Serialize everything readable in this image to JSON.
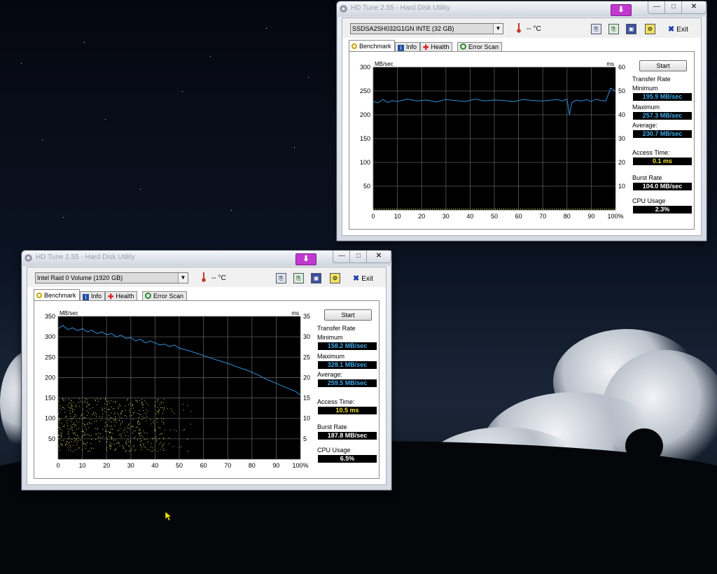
{
  "desktop": {
    "background": "night-sky-clouds"
  },
  "window_top": {
    "title": "HD Tune 2.55 - Hard Disk Utility",
    "drive": "SSDSA2SH032G1GN INTE (32 GB)",
    "temp": "-- °C",
    "exit_label": "Exit",
    "tabs": [
      "Benchmark",
      "Info",
      "Health",
      "Error Scan"
    ],
    "start_label": "Start",
    "stats": {
      "transfer_rate_label": "Transfer Rate",
      "minimum_label": "Minimum",
      "minimum": "195.9 MB/sec",
      "maximum_label": "Maximum",
      "maximum": "257.3 MB/sec",
      "average_label": "Average:",
      "average": "230.7 MB/sec",
      "access_time_label": "Access Time:",
      "access_time": "0.1 ms",
      "burst_rate_label": "Burst Rate",
      "burst_rate": "104.0 MB/sec",
      "cpu_usage_label": "CPU Usage",
      "cpu_usage": "2.3%"
    }
  },
  "window_bottom": {
    "title": "HD Tune 2.55 - Hard Disk Utility",
    "drive": "Intel   Raid 0 Volume (1920 GB)",
    "temp": "-- °C",
    "exit_label": "Exit",
    "tabs": [
      "Benchmark",
      "Info",
      "Health",
      "Error Scan"
    ],
    "start_label": "Start",
    "stats": {
      "transfer_rate_label": "Transfer Rate",
      "minimum_label": "Minimum",
      "minimum": "158.2 MB/sec",
      "maximum_label": "Maximum",
      "maximum": "328.1 MB/sec",
      "average_label": "Average:",
      "average": "259.5 MB/sec",
      "access_time_label": "Access Time:",
      "access_time": "10.5 ms",
      "burst_rate_label": "Burst Rate",
      "burst_rate": "187.8 MB/sec",
      "cpu_usage_label": "CPU Usage",
      "cpu_usage": "6.5%"
    }
  },
  "chart_data": [
    {
      "type": "line",
      "ylabel": "MB/sec",
      "y2label": "ms",
      "ylim": [
        0,
        300
      ],
      "y2lim": [
        0,
        60
      ],
      "yticks": [
        "300",
        "250",
        "200",
        "150",
        "100",
        "50"
      ],
      "y2ticks": [
        "60",
        "50",
        "40",
        "30",
        "20",
        "10"
      ],
      "xticks": [
        "0",
        "10",
        "20",
        "30",
        "40",
        "50",
        "60",
        "70",
        "80",
        "90",
        "100%"
      ],
      "grid": true,
      "series": [
        {
          "x": [
            0,
            2,
            4,
            6,
            8,
            10,
            14,
            18,
            22,
            26,
            30,
            34,
            38,
            42,
            46,
            50,
            54,
            58,
            62,
            66,
            70,
            74,
            76,
            78,
            80,
            81,
            82,
            84,
            86,
            88,
            90,
            92,
            94,
            96,
            98,
            100
          ],
          "values": [
            228,
            225,
            232,
            226,
            230,
            228,
            233,
            229,
            231,
            227,
            232,
            230,
            228,
            233,
            229,
            231,
            230,
            228,
            232,
            230,
            229,
            231,
            232,
            229,
            233,
            200,
            226,
            231,
            229,
            232,
            228,
            233,
            230,
            229,
            256,
            250
          ]
        }
      ],
      "access_time_points_ms": [
        0.1
      ]
    },
    {
      "type": "line",
      "ylabel": "MB/sec",
      "y2label": "ms",
      "ylim": [
        0,
        350
      ],
      "y2lim": [
        0,
        35
      ],
      "yticks": [
        "350",
        "300",
        "250",
        "200",
        "150",
        "100",
        "50"
      ],
      "y2ticks": [
        "35",
        "30",
        "25",
        "20",
        "15",
        "10",
        "5"
      ],
      "xticks": [
        "0",
        "10",
        "20",
        "30",
        "40",
        "50",
        "60",
        "70",
        "80",
        "90",
        "100%"
      ],
      "grid": true,
      "series": [
        {
          "x": [
            0,
            2,
            4,
            6,
            8,
            10,
            12,
            14,
            16,
            18,
            20,
            22,
            24,
            26,
            28,
            30,
            32,
            34,
            36,
            38,
            40,
            42,
            44,
            46,
            48,
            50,
            54,
            58,
            62,
            66,
            70,
            74,
            78,
            82,
            86,
            90,
            94,
            98,
            100
          ],
          "values": [
            320,
            328,
            318,
            322,
            315,
            320,
            312,
            316,
            308,
            312,
            305,
            308,
            300,
            304,
            296,
            298,
            290,
            294,
            285,
            290,
            285,
            280,
            282,
            276,
            280,
            272,
            266,
            258,
            250,
            242,
            235,
            226,
            218,
            208,
            196,
            186,
            176,
            166,
            158
          ]
        }
      ],
      "access_time_scatter_ms": {
        "x_range": [
          0,
          55
        ],
        "y_range": [
          2,
          15
        ]
      }
    }
  ]
}
